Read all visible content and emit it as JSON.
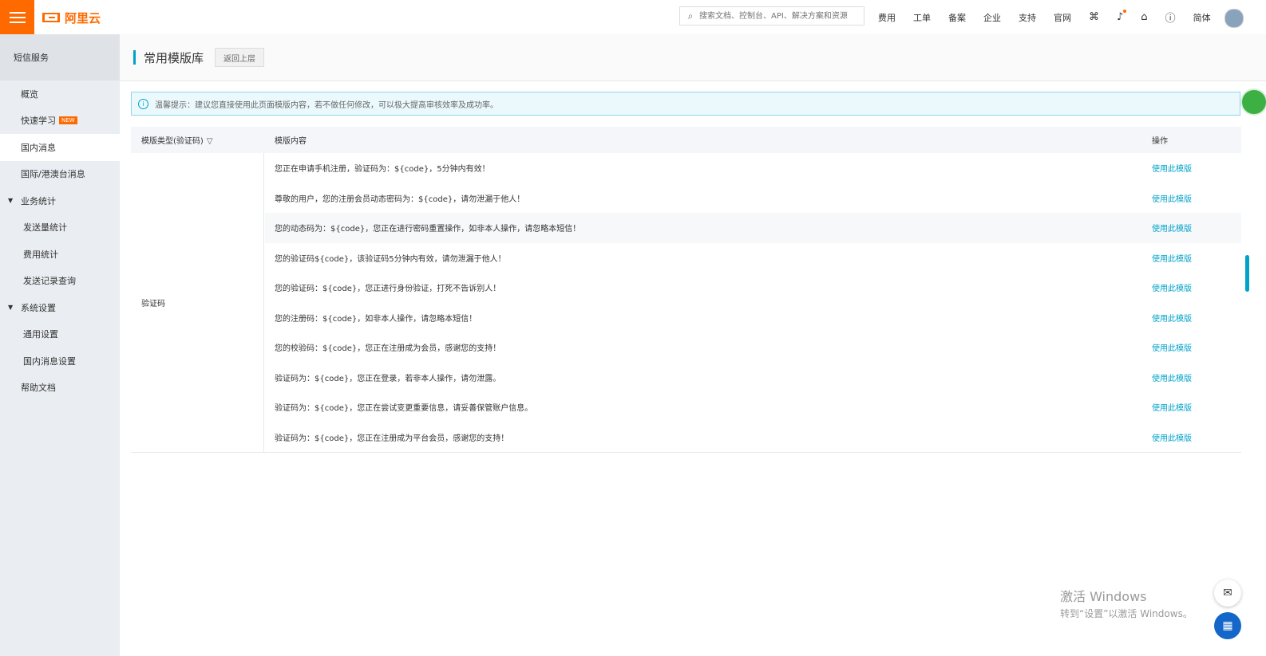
{
  "topbar": {
    "logo_text": "阿里云",
    "search_placeholder": "搜索文档、控制台、API、解决方案和资源",
    "nav": [
      "费用",
      "工单",
      "备案",
      "企业",
      "支持",
      "官网"
    ],
    "lang": "简体"
  },
  "sidebar": {
    "title": "短信服务",
    "items": [
      {
        "label": "概览"
      },
      {
        "label": "快速学习",
        "badge": "NEW"
      },
      {
        "label": "国内消息"
      },
      {
        "label": "国际/港澳台消息"
      },
      {
        "label": "业务统计"
      },
      {
        "label": "发送量统计"
      },
      {
        "label": "费用统计"
      },
      {
        "label": "发送记录查询"
      },
      {
        "label": "系统设置"
      },
      {
        "label": "通用设置"
      },
      {
        "label": "国内消息设置"
      },
      {
        "label": "帮助文档"
      }
    ]
  },
  "header": {
    "title": "常用模版库",
    "back_label": "返回上层"
  },
  "notice": {
    "text": "温馨提示：建议您直接使用此页面模版内容，若不做任何修改，可以极大提高审核效率及成功率。"
  },
  "table": {
    "columns": [
      "模版类型(验证码)",
      "模版内容",
      "操作"
    ],
    "type_value": "验证码",
    "action_label": "使用此模版",
    "rows": [
      "您正在申请手机注册，验证码为：${code}，5分钟内有效！",
      "尊敬的用户，您的注册会员动态密码为：${code}，请勿泄漏于他人！",
      "您的动态码为：${code}，您正在进行密码重置操作，如非本人操作，请忽略本短信！",
      "您的验证码${code}，该验证码5分钟内有效，请勿泄漏于他人！",
      "您的验证码：${code}，您正进行身份验证，打死不告诉别人！",
      "您的注册码：${code}，如非本人操作，请忽略本短信！",
      "您的校验码：${code}，您正在注册成为会员，感谢您的支持！",
      "验证码为：${code}，您正在登录，若非本人操作，请勿泄露。",
      "验证码为：${code}，您正在尝试变更重要信息，请妥善保管账户信息。",
      "验证码为：${code}，您正在注册成为平台会员，感谢您的支持！"
    ]
  },
  "watermark": {
    "line1": "激活 Windows",
    "line2": "转到“设置”以激活 Windows。"
  },
  "colors": {
    "brand": "#ff6a00",
    "link": "#00a2ca"
  }
}
